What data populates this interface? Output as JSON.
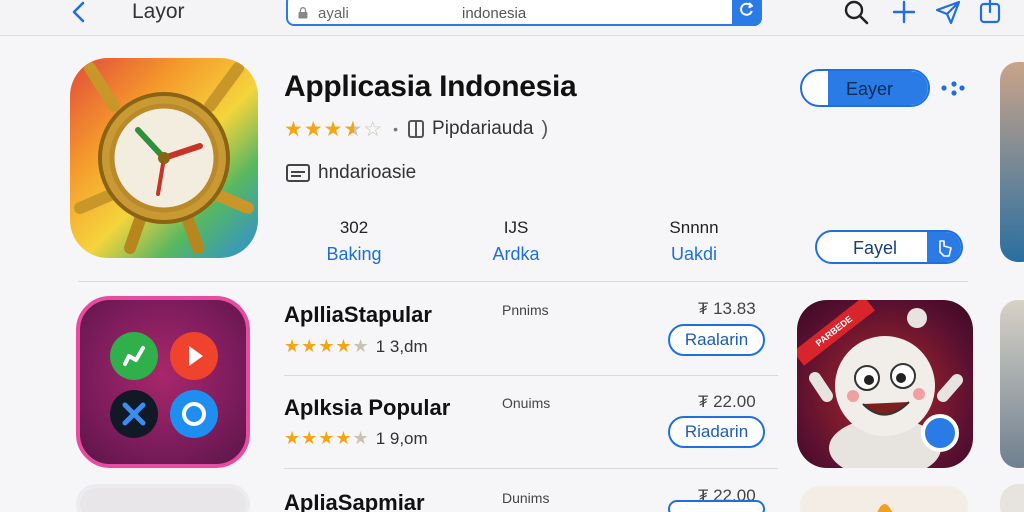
{
  "nav": {
    "title": "Layor",
    "search_query": "ayali",
    "search_hint": "indonesia",
    "accent": "#2a7be6"
  },
  "hero": {
    "title": "Applicasia Indonesia",
    "rating": 3.5,
    "publisher": "Pipdariauda",
    "developer": "hndarioasie",
    "primary_button": "Eayer",
    "secondary_button": "Fayel",
    "stats": [
      {
        "value": "302",
        "label": "Baking"
      },
      {
        "value": "IJS",
        "label": "Ardka"
      },
      {
        "value": "Snnnn",
        "label": "Uakdi"
      }
    ]
  },
  "list": [
    {
      "title": "ApIliaStapular",
      "rating": 4.5,
      "count": "1 3,dm",
      "meta": "Pnnims",
      "price": "₮ 13.83",
      "button": "Raalarin"
    },
    {
      "title": "ApIksia Popular",
      "rating": 4.5,
      "count": "1 9,om",
      "meta": "Onuims",
      "price": "₮ 22.00",
      "button": "Riadarin"
    },
    {
      "title": "ApIiaSapmiar",
      "meta": "Dunims",
      "price": "₮ 22.00"
    }
  ],
  "feature_card": {
    "badge": "PARBEDE"
  }
}
